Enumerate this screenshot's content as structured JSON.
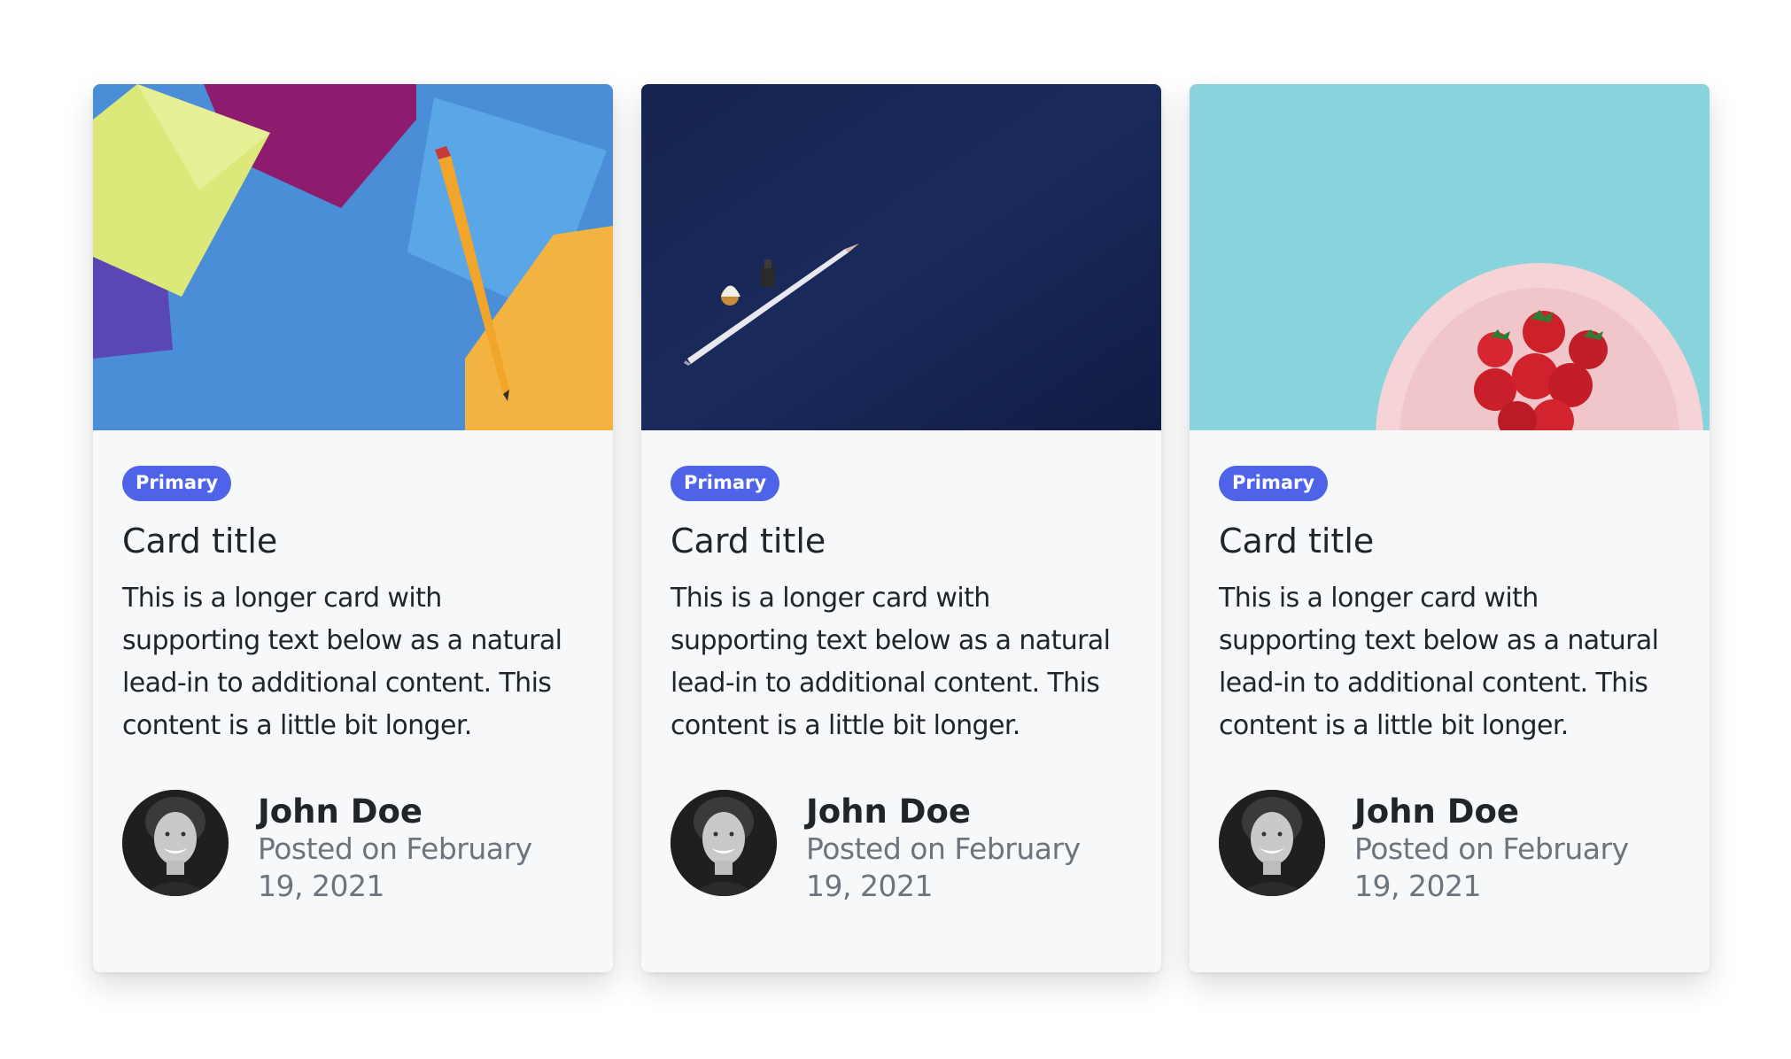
{
  "cards": [
    {
      "image": "blue-envelopes-pencil-photo",
      "badge": "Primary",
      "title": "Card title",
      "text": "This is a longer card with supporting text below as a natural lead-in to additional content. This content is a little bit longer.",
      "author_name": "John Doe",
      "author_date": "Posted on February 19, 2021"
    },
    {
      "image": "navy-desk-pencil-photo",
      "badge": "Primary",
      "title": "Card title",
      "text": "This is a longer card with supporting text below as a natural lead-in to additional content. This content is a little bit longer.",
      "author_name": "John Doe",
      "author_date": "Posted on February 19, 2021"
    },
    {
      "image": "strawberries-plate-photo",
      "badge": "Primary",
      "title": "Card title",
      "text": "This is a longer card with supporting text below as a natural lead-in to additional content. This content is a little bit longer.",
      "author_name": "John Doe",
      "author_date": "Posted on February 19, 2021"
    }
  ],
  "colors": {
    "badge_bg": "#4f63e8",
    "card_bg": "#f7f8fa",
    "text": "#212529",
    "muted": "#6c757d"
  }
}
